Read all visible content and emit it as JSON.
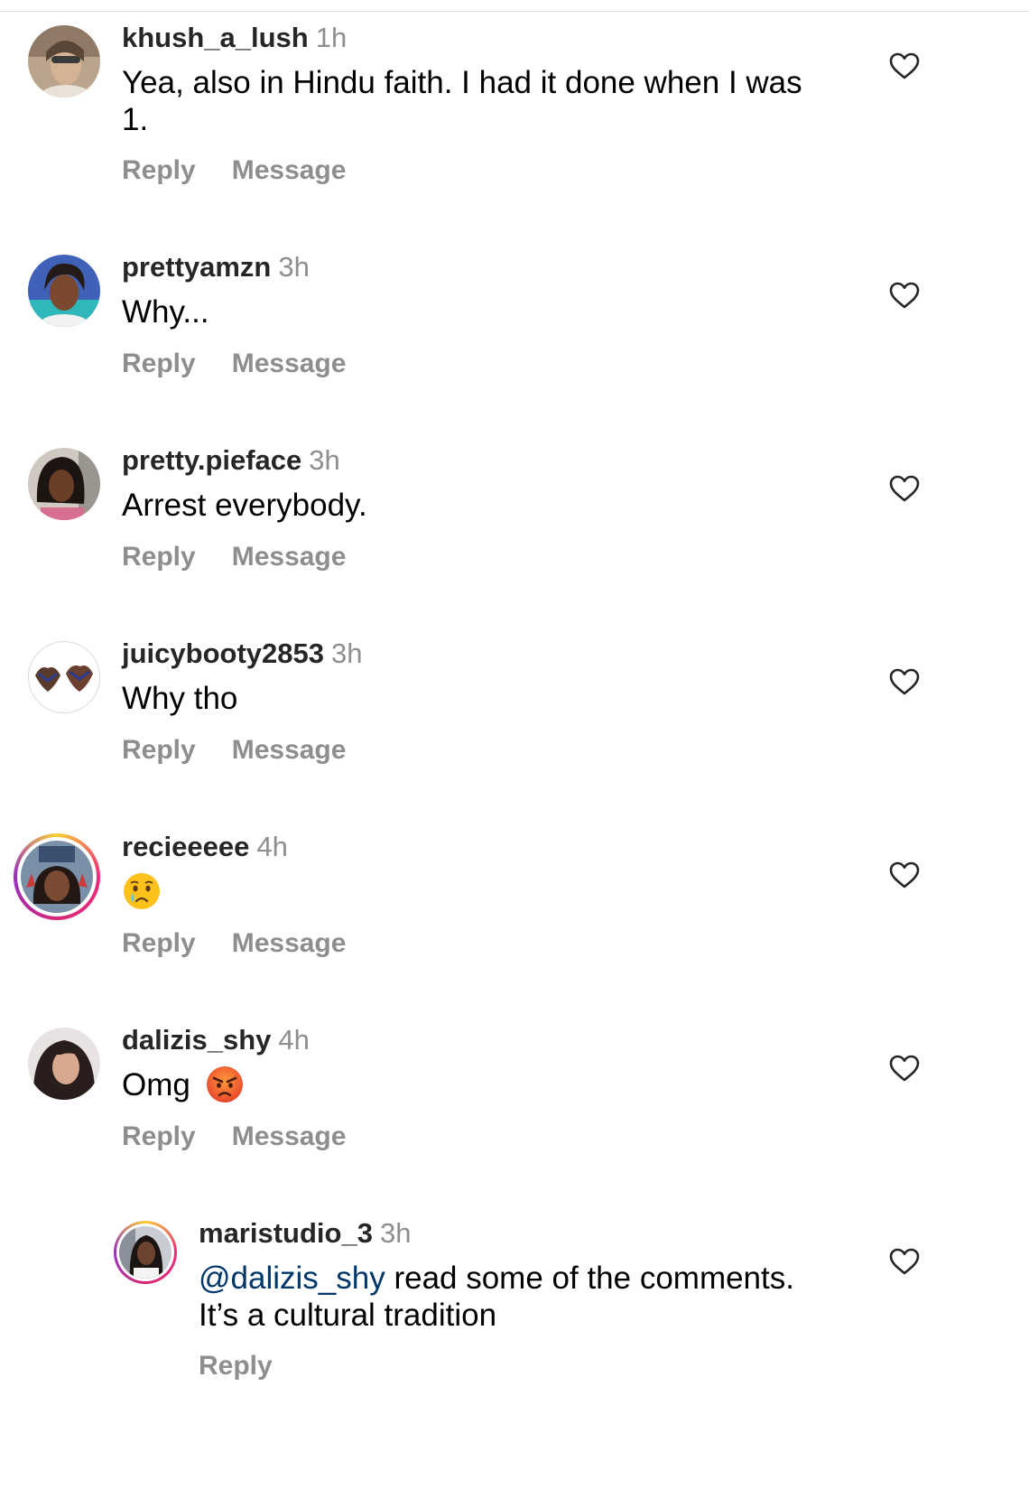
{
  "comments": [
    {
      "username": "khush_a_lush",
      "time": "1h",
      "text": "Yea, also in Hindu faith. I had it done when I was 1.",
      "reply_label": "Reply",
      "message_label": "Message"
    },
    {
      "username": "prettyamzn",
      "time": "3h",
      "text": "Why...",
      "reply_label": "Reply",
      "message_label": "Message"
    },
    {
      "username": "pretty.pieface",
      "time": "3h",
      "text": "Arrest everybody.",
      "reply_label": "Reply",
      "message_label": "Message"
    },
    {
      "username": "juicybooty2853",
      "time": "3h",
      "text": "Why tho",
      "reply_label": "Reply",
      "message_label": "Message"
    },
    {
      "username": "recieeeee",
      "time": "4h",
      "emoji": "crying-face-emoji",
      "reply_label": "Reply",
      "message_label": "Message"
    },
    {
      "username": "dalizis_shy",
      "time": "4h",
      "text": "Omg",
      "emoji": "angry-face-emoji",
      "reply_label": "Reply",
      "message_label": "Message"
    }
  ],
  "reply": {
    "username": "maristudio_3",
    "time": "3h",
    "mention": "@dalizis_shy",
    "text_after_mention": " read some of the comments.",
    "text_line2": "It’s a cultural tradition",
    "reply_label": "Reply"
  },
  "colors": {
    "username": "#262626",
    "meta_gray": "#8e8e8e",
    "mention": "#00376b",
    "divider": "#dbdbdb"
  },
  "icons": {
    "like": "heart-outline-icon"
  }
}
